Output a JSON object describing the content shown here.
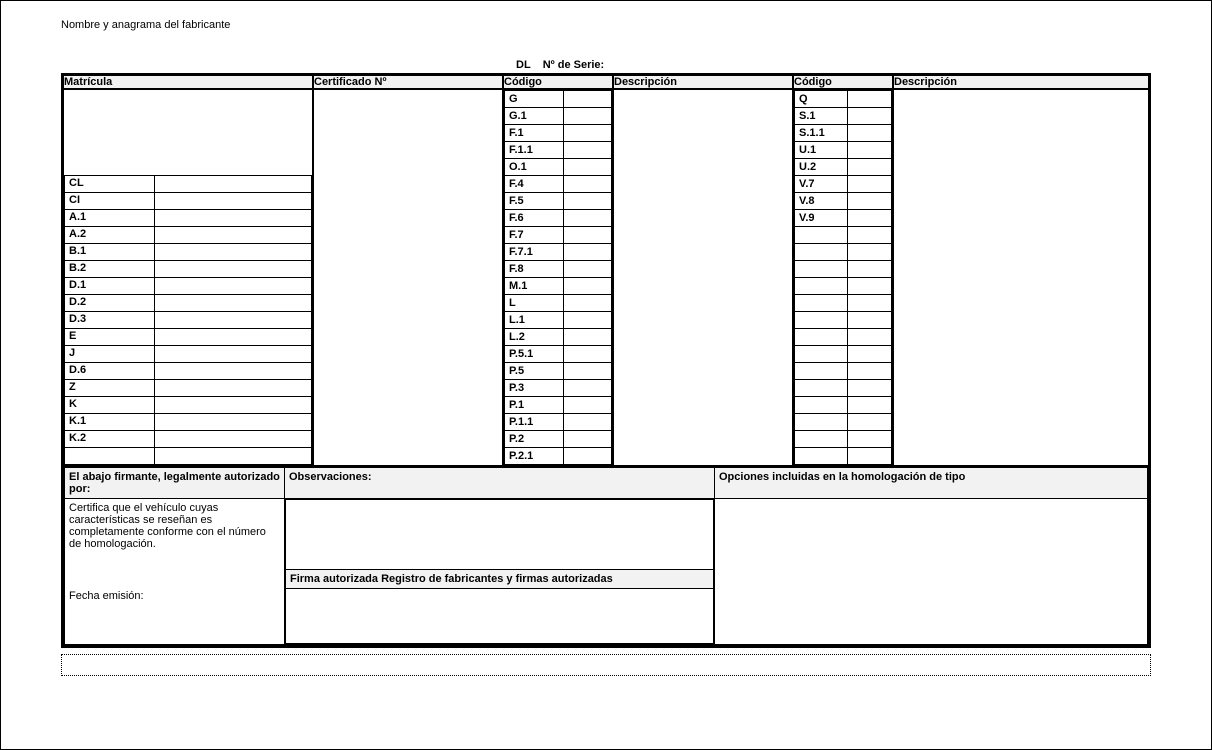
{
  "top_title": "Nombre y anagrama del fabricante",
  "dl_label": "DL",
  "serie_label": "Nº de Serie:",
  "headers": {
    "matricula": "Matrícula",
    "certificado": "Certificado Nº",
    "codigo": "Código",
    "descripcion": "Descripción"
  },
  "left_codes": [
    "CL",
    "CI",
    "A.1",
    "A.2",
    "B.1",
    "B.2",
    "D.1",
    "D.2",
    "D.3",
    "E",
    "J",
    "D.6",
    "Z",
    "K",
    "K.1",
    "K.2",
    ""
  ],
  "mid_codes_top5": [
    "G",
    "G.1",
    "F.1",
    "F.1.1",
    "O.1"
  ],
  "mid_codes_rest": [
    "F.4",
    "F.5",
    "F.6",
    "F.7",
    "F.7.1",
    "F.8",
    "M.1",
    "L",
    "L.1",
    "L.2",
    "P.5.1",
    "P.5",
    "P.3",
    "P.1",
    "P.1.1",
    "P.2",
    "P.2.1"
  ],
  "right_codes_top5": [
    "Q",
    "S.1",
    "S.1.1",
    "U.1",
    "U.2"
  ],
  "right_codes_rest": [
    "V.7",
    "V.8",
    "V.9",
    "",
    "",
    "",
    "",
    "",
    "",
    "",
    "",
    "",
    "",
    "",
    "",
    "",
    ""
  ],
  "footer": {
    "signer_header": "El abajo firmante, legalmente autorizado por:",
    "obs_header": "Observaciones:",
    "opt_header": "Opciones incluidas en la homologación de tipo",
    "cert_text": "Certifica que el vehículo cuyas características se reseñan es completamente conforme con el número de homologación.",
    "fecha": "Fecha emisión:",
    "firma_header": "Firma autorizada Registro de fabricantes y firmas autorizadas"
  }
}
